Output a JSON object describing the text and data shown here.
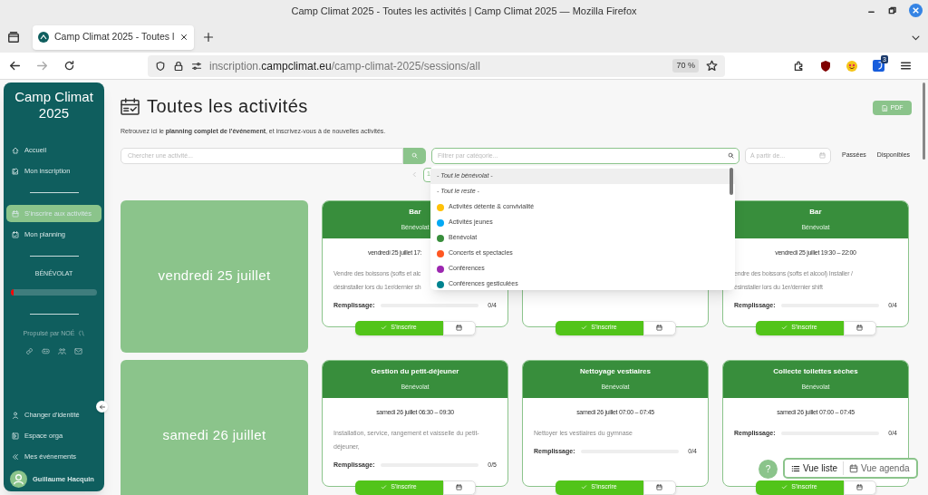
{
  "window": {
    "title": "Camp Climat 2025 - Toutes les activités | Camp Climat 2025 — Mozilla Firefox"
  },
  "tabs": [
    {
      "label": "Camp Climat 2025 - Toutes l",
      "selected": true
    }
  ],
  "address_bar": {
    "url_prefix": "inscription.",
    "url_domain": "campclimat.eu",
    "url_path": "/camp-climat-2025/sessions/all",
    "zoom": "70 %",
    "extension_badge": "3"
  },
  "sidebar": {
    "title": "Camp Climat 2025",
    "top_items": [
      {
        "label": "Accueil",
        "selected": false
      },
      {
        "label": "Mon inscription",
        "selected": false
      }
    ],
    "mid_items": [
      {
        "label": "S'inscrire aux activités",
        "selected": true
      },
      {
        "label": "Mon planning",
        "selected": false
      }
    ],
    "role": "BÉNÉVOLAT",
    "progress": {
      "level": 0.03
    },
    "powered_by": "Propulsé par NOÉ",
    "bottom_items": [
      {
        "label": "Changer d'identité",
        "selected": false
      },
      {
        "label": "Espace orga",
        "selected": false
      },
      {
        "label": "Mes événements",
        "selected": false
      }
    ],
    "user": "Guillaume Hacquin"
  },
  "page": {
    "title": "Toutes les activités",
    "subtitle": "Retrouvez ici le **planning complet de l'événement**, et inscrivez-vous à de nouvelles activités.",
    "pdf_button": "PDF",
    "search": {
      "placeholder": "Chercher une activité..."
    },
    "category_filter": {
      "placeholder": "Filtrer par catégorie..."
    },
    "date_filter": {
      "placeholder": "À partir de..."
    },
    "toggles": [
      "Passées",
      "Disponibles"
    ],
    "page_number": "1"
  },
  "category_dropdown": [
    {
      "kind": "group",
      "label": "- Tout le bénévolat -",
      "highlighted": true
    },
    {
      "kind": "group",
      "label": "- Tout le reste -",
      "highlighted": false
    },
    {
      "kind": "category",
      "label": "Activités détente & convivialité",
      "color": "#ffc107",
      "highlighted": false
    },
    {
      "kind": "category",
      "label": "Activités jeunes",
      "color": "#03a9f4",
      "highlighted": false
    },
    {
      "kind": "category",
      "label": "Bénévolat",
      "color": "#388e3c",
      "highlighted": false
    },
    {
      "kind": "category",
      "label": "Concerts et spectacles",
      "color": "#ff5722",
      "highlighted": false
    },
    {
      "kind": "category",
      "label": "Conférences",
      "color": "#9c27b0",
      "highlighted": false
    },
    {
      "kind": "category",
      "label": "Conférences gesticulées",
      "color": "#00838f",
      "highlighted": false
    }
  ],
  "days": [
    {
      "date": "vendredi 25 juillet",
      "activities": [
        {
          "title": "Bar",
          "category": "Bénévolat",
          "time": "vendredi 25 juillet 17:",
          "covered_by_dropdown": true,
          "description": "Vendre des boissons (softs et alc",
          "description_2": "désinstaller lors du 1er/dernier sh",
          "fill_label": "Remplissage:",
          "count": "0/4",
          "level": 0,
          "button": "S'inscrire"
        },
        {
          "button": "S'inscrire"
        },
        {
          "title": "Bar",
          "category": "Bénévolat",
          "time": "vendredi 25 juillet 19:30 – 22:00",
          "description": "endre des boissons (softs et alcool) Installer /",
          "description_2": "ésinstaller lors du 1er/dernier shift",
          "fill_label": "Remplissage:",
          "count": "0/4",
          "level": 0,
          "button": "S'inscrire"
        }
      ]
    },
    {
      "date": "samedi 26 juillet",
      "activities": [
        {
          "title": "Gestion du petit-déjeuner",
          "category": "Bénévolat",
          "time": "samedi 26 juillet 06:30 – 09:30",
          "description": "Installation, service, rangement et vaisselle du petit-déjeuner,",
          "fill_label": "Remplissage:",
          "count": "0/5",
          "level": 0,
          "button": "S'inscrire"
        },
        {
          "title": "Nettoyage vestiaires",
          "category": "Bénévolat",
          "time": "samedi 26 juillet 07:00 – 07:45",
          "description": "Nettoyer les vestiaires du gymnase",
          "fill_label": "Remplissage:",
          "count": "0/4",
          "level": 0,
          "button": "S'inscrire"
        },
        {
          "title": "Collecte toilettes sèches",
          "category": "Bénévolat",
          "time": "samedi 26 juillet 07:00 – 07:45",
          "fill_label": "Remplissage:",
          "count": "0/4",
          "level": 0,
          "button": "S'inscrire"
        }
      ]
    }
  ],
  "help_button": "?",
  "views": [
    {
      "label": "Vue liste",
      "selected": true
    },
    {
      "label": "Vue agenda",
      "selected": false
    }
  ]
}
